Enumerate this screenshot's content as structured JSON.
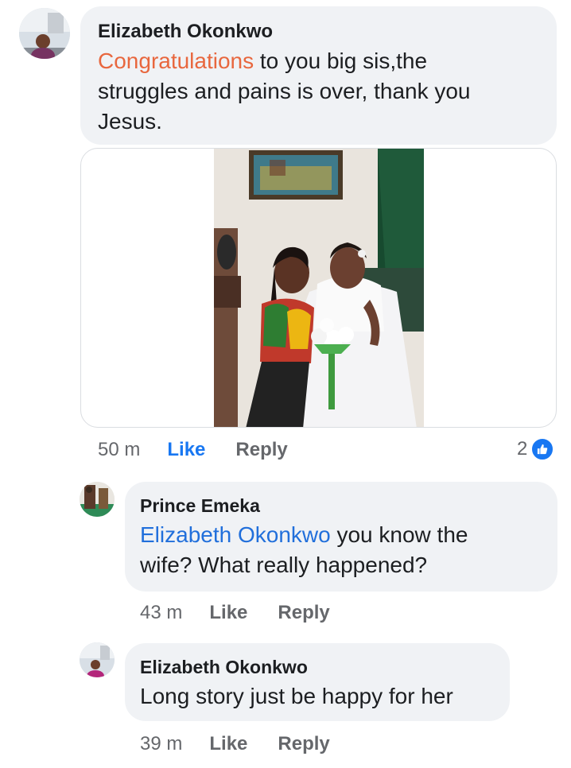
{
  "comments": [
    {
      "author": "Elizabeth Okonkwo",
      "text_highlight": "Congratulations",
      "text_rest_1": " to you big sis,the",
      "text_line_2": "struggles and pains is over, thank you",
      "text_line_3": "Jesus.",
      "time": "50 m",
      "like_label": "Like",
      "reply_label": "Reply",
      "reaction_count": "2"
    },
    {
      "author": "Prince Emeka",
      "mention": "Elizabeth Okonkwo",
      "text_rest_1": " you know the",
      "text_line_2": "wife? What really happened?",
      "time": "43 m",
      "like_label": "Like",
      "reply_label": "Reply"
    },
    {
      "author": "Elizabeth Okonkwo",
      "text_line_1": "Long story just be happy for her",
      "time": "39 m",
      "like_label": "Like",
      "reply_label": "Reply"
    }
  ],
  "colors": {
    "bubble": "#f0f2f5",
    "like_blue": "#1877f2",
    "mention": "#216fdb",
    "highlight": "#e8673e",
    "meta": "#65676b"
  },
  "icons": [
    "like-thumb-icon"
  ]
}
